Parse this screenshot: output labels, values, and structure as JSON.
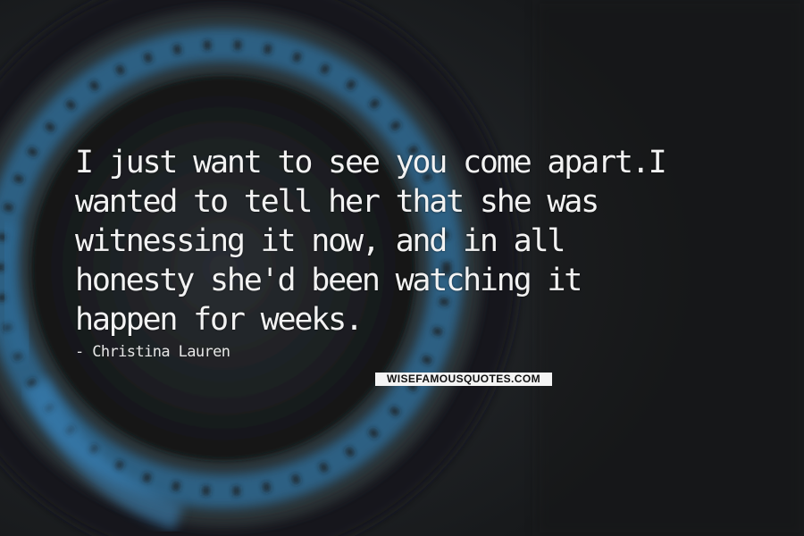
{
  "quote": {
    "lines": [
      "I just want to see you come apart.I",
      "wanted to tell her that she was",
      "witnessing it now, and in all",
      "honesty she'd been watching it",
      "happen for weeks."
    ]
  },
  "author": "- Christina Lauren",
  "watermark": "WISEFAMOUSQUOTES.COM",
  "colors": {
    "background": "#1d1f21",
    "accent_blue": "#2f6f9e",
    "text": "#f2f2f2"
  }
}
